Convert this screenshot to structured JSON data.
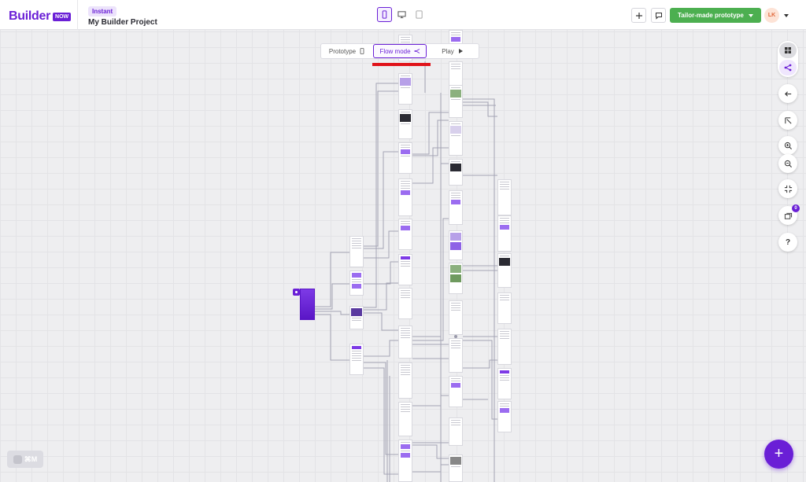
{
  "app": {
    "logo_text": "Builder",
    "logo_badge": "NOW",
    "project_tag": "Instant",
    "project_name": "My Builder Project"
  },
  "header": {
    "devices": [
      "mobile",
      "desktop",
      "tablet"
    ],
    "active_device": "mobile",
    "cta_label": "Tailor-made prototype",
    "avatar_initials": "LK"
  },
  "mode_switch": {
    "tabs": [
      {
        "label": "Prototype",
        "icon": "phone-icon"
      },
      {
        "label": "Flow mode",
        "icon": "flow-icon"
      },
      {
        "label": "Play",
        "icon": "play-icon"
      }
    ],
    "active": "Flow mode"
  },
  "right_toolbar": {
    "tools": [
      "grid-view-icon",
      "flow-view-icon",
      "back-arrow-icon",
      "reset-icon",
      "zoom-in-icon",
      "zoom-out-icon",
      "fit-screen-icon",
      "stack-icon",
      "help-icon"
    ],
    "badge_count": "0"
  },
  "shortcut": {
    "label": "⌘M"
  },
  "fab": {
    "label": "+"
  },
  "colors": {
    "brand": "#6a1fd6",
    "cta": "#4caf50",
    "alert_underline": "#e0131a"
  }
}
